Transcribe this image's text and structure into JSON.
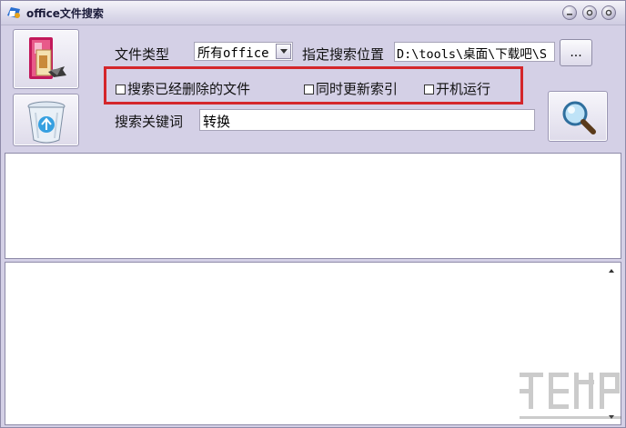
{
  "window": {
    "title": "office文件搜索"
  },
  "form": {
    "file_type_label": "文件类型",
    "file_type_value": "所有office",
    "location_label": "指定搜索位置",
    "location_value": "D:\\tools\\桌面\\下载吧\\S",
    "browse_label": "...",
    "keyword_label": "搜索关键词",
    "keyword_value": "转换"
  },
  "options": {
    "search_deleted": {
      "label": "搜索已经删除的文件",
      "checked": false
    },
    "update_index": {
      "label": "同时更新索引",
      "checked": false
    },
    "run_on_startup": {
      "label": "开机运行",
      "checked": false
    }
  },
  "icons": {
    "app": "office-app-icon",
    "office": "office-documents-icon",
    "recycle": "recycle-bin-icon",
    "search": "magnifier-icon"
  },
  "colors": {
    "highlight": "#d4262b",
    "window_bg": "#d4d0e6"
  }
}
